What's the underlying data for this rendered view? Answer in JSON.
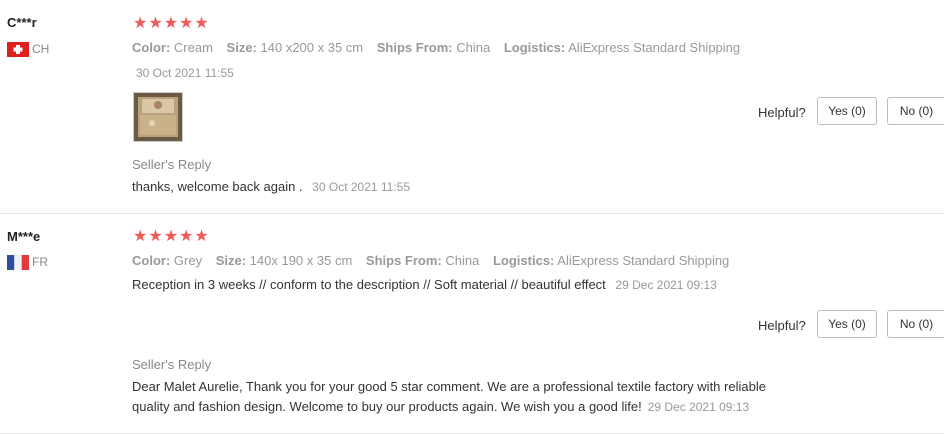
{
  "reviews": [
    {
      "user": "C***r",
      "country": "CH",
      "stars": "★★★★★",
      "attributes": [
        {
          "key": "Color:",
          "value": "Cream"
        },
        {
          "key": "Size:",
          "value": "140 x200 x 35 cm"
        },
        {
          "key": "Ships From:",
          "value": "China"
        },
        {
          "key": "Logistics:",
          "value": "AliExpress Standard Shipping"
        }
      ],
      "date": "30 Oct 2021 11:55",
      "helpful_label": "Helpful?",
      "yes_label": "Yes (0)",
      "no_label": "No (0)",
      "seller_reply_label": "Seller's Reply",
      "seller_reply_text": "thanks, welcome back again .",
      "seller_reply_date": "30 Oct 2021 11:55"
    },
    {
      "user": "M***e",
      "country": "FR",
      "stars": "★★★★★",
      "attributes": [
        {
          "key": "Color:",
          "value": "Grey"
        },
        {
          "key": "Size:",
          "value": "140x 190 x 35 cm"
        },
        {
          "key": "Ships From:",
          "value": "China"
        },
        {
          "key": "Logistics:",
          "value": "AliExpress Standard Shipping"
        }
      ],
      "text": "Reception in 3 weeks // conform to the description // Soft material // beautiful effect",
      "date": "29 Dec 2021 09:13",
      "helpful_label": "Helpful?",
      "yes_label": "Yes (0)",
      "no_label": "No (0)",
      "seller_reply_label": "Seller's Reply",
      "seller_reply_line1": "Dear Malet Aurelie, Thank you for your good 5 star comment. We are a professional textile factory with reliable",
      "seller_reply_line2": "quality and fashion design. Welcome to buy our products again. We wish you a good life!",
      "seller_reply_date": "29 Dec 2021 09:13"
    }
  ],
  "colors": {
    "star": "#f25a5a",
    "swiss_red": "#e0201c",
    "fr_blue": "#2d4ea0",
    "fr_red": "#e03a3e"
  }
}
